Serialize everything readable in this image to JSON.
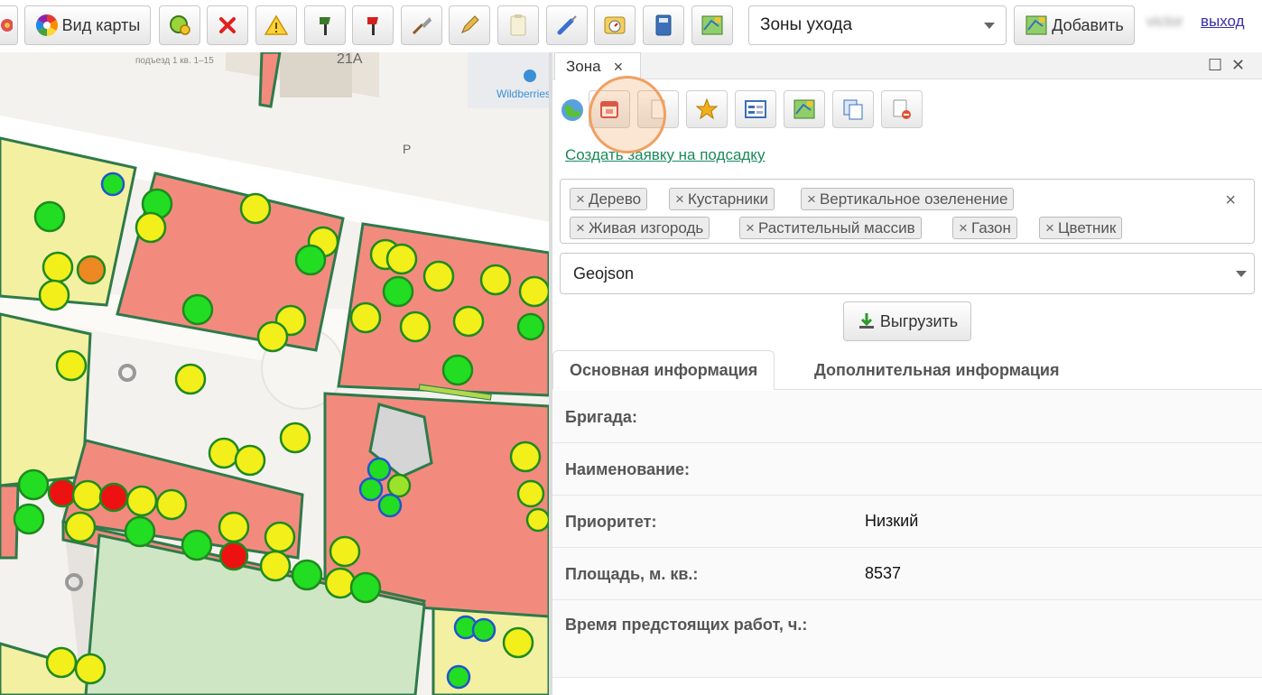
{
  "toolbar": {
    "map_view_label": "Вид карты",
    "layer_select_value": "Зоны ухода",
    "add_label": "Добавить",
    "user_name": "victor",
    "logout_label": "выход"
  },
  "panel": {
    "tab_title": "Зона",
    "create_link": "Создать заявку на подсадку",
    "tags": [
      "Дерево",
      "Кустарники",
      "Вертикальное озеленение",
      "Живая изгородь",
      "Растительный массив",
      "Газон",
      "Цветник"
    ],
    "format_value": "Geojson",
    "export_label": "Выгрузить",
    "tabs": [
      "Основная информация",
      "Дополнительная информация"
    ],
    "fields": [
      {
        "label": "Бригада:",
        "value": ""
      },
      {
        "label": "Наименование:",
        "value": ""
      },
      {
        "label": "Приоритет:",
        "value": "Низкий"
      },
      {
        "label": "Площадь, м. кв.:",
        "value": "8537"
      },
      {
        "label": "Время предстоящих работ, ч.:",
        "value": ""
      }
    ]
  },
  "map": {
    "labels": {
      "building_number": "21А",
      "poi": "Wildberries",
      "parking": "P",
      "address": "подъезд 1 кв. 1–15"
    }
  },
  "colors": {
    "zone_fill": "#f28b7e",
    "zone_yellow": "#f3f0a2",
    "lawn": "#cfe6c4",
    "zone_stroke": "#2e7a4a",
    "tree_green": "#22dd22",
    "tree_yellow": "#f2ef1a",
    "tree_red": "#ee1111",
    "tree_orange": "#ee8822",
    "tree_blue_stroke": "#2255cc",
    "highlight": "#f0a060",
    "link": "#1a8a5a"
  }
}
